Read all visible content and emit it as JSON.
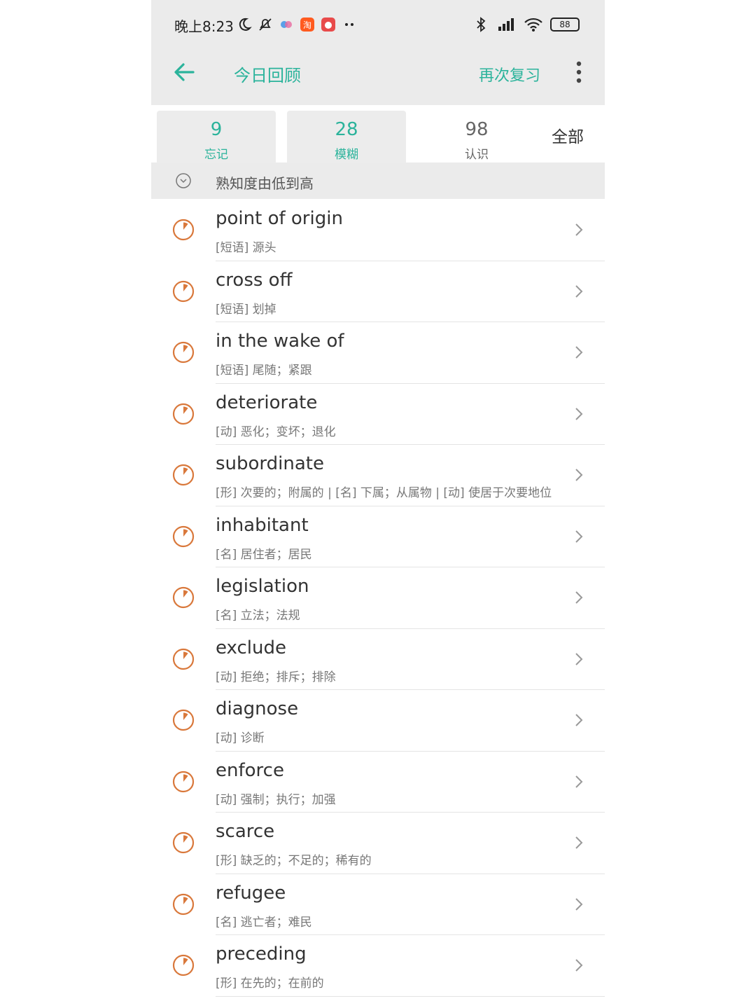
{
  "status_bar": {
    "time": "晚上8:23",
    "battery": "88",
    "icons_left": [
      "moon-icon",
      "mute-icon",
      "app-icon",
      "taobao-icon",
      "app2-icon",
      "more-dots-icon"
    ],
    "icons_right": [
      "bluetooth-icon",
      "signal-icon",
      "wifi-icon",
      "battery-icon"
    ]
  },
  "header": {
    "title": "今日回顾",
    "review_label": "再次复习"
  },
  "tabs": [
    {
      "count": "9",
      "label": "忘记"
    },
    {
      "count": "28",
      "label": "模糊"
    },
    {
      "count": "98",
      "label": "认识"
    }
  ],
  "tab_all": "全部",
  "sort": {
    "label": "熟知度由低到高"
  },
  "words": [
    {
      "word": "point of origin",
      "def": "[短语] 源头"
    },
    {
      "word": "cross off",
      "def": "[短语] 划掉"
    },
    {
      "word": "in the wake of",
      "def": "[短语] 尾随；紧跟"
    },
    {
      "word": "deteriorate",
      "def": "[动] 恶化；变坏；退化"
    },
    {
      "word": "subordinate",
      "def": "[形] 次要的；附属的 | [名] 下属；从属物 | [动] 使居于次要地位"
    },
    {
      "word": "inhabitant",
      "def": "[名] 居住者；居民"
    },
    {
      "word": "legislation",
      "def": "[名] 立法；法规"
    },
    {
      "word": "exclude",
      "def": "[动] 拒绝；排斥；排除"
    },
    {
      "word": "diagnose",
      "def": "[动] 诊断"
    },
    {
      "word": "enforce",
      "def": "[动] 强制；执行；加强"
    },
    {
      "word": "scarce",
      "def": "[形] 缺乏的；不足的；稀有的"
    },
    {
      "word": "refugee",
      "def": "[名] 逃亡者；难民"
    },
    {
      "word": "preceding",
      "def": "[形] 在先的；在前的"
    }
  ],
  "colors": {
    "accent": "#2bb39b",
    "pie": "#d9783b",
    "bar_bg": "#ebebeb"
  }
}
